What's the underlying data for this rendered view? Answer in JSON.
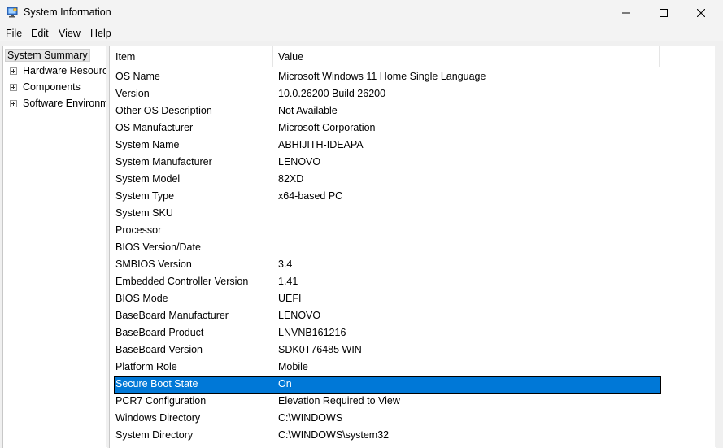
{
  "window": {
    "title": "System Information",
    "icon": "system-info-icon"
  },
  "menu": [
    "File",
    "Edit",
    "View",
    "Help"
  ],
  "tree": {
    "items": [
      {
        "label": "System Summary",
        "selected": true
      },
      {
        "label": "Hardware Resources",
        "expander": "+"
      },
      {
        "label": "Components",
        "expander": "+"
      },
      {
        "label": "Software Environment",
        "expander": "+"
      }
    ]
  },
  "table": {
    "columns": [
      "Item",
      "Value"
    ],
    "rows": [
      [
        "OS Name",
        "Microsoft Windows 11 Home Single Language"
      ],
      [
        "Version",
        "10.0.26200 Build 26200"
      ],
      [
        "Other OS Description",
        "Not Available"
      ],
      [
        "OS Manufacturer",
        "Microsoft Corporation"
      ],
      [
        "System Name",
        "ABHIJITH-IDEAPA"
      ],
      [
        "System Manufacturer",
        "LENOVO"
      ],
      [
        "System Model",
        "82XD"
      ],
      [
        "System Type",
        "x64-based PC"
      ],
      [
        "System SKU",
        ""
      ],
      [
        "Processor",
        ""
      ],
      [
        "BIOS Version/Date",
        ""
      ],
      [
        "SMBIOS Version",
        "3.4"
      ],
      [
        "Embedded Controller Version",
        "1.41"
      ],
      [
        "BIOS Mode",
        "UEFI"
      ],
      [
        "BaseBoard Manufacturer",
        "LENOVO"
      ],
      [
        "BaseBoard Product",
        "LNVNB161216"
      ],
      [
        "BaseBoard Version",
        "SDK0T76485 WIN"
      ],
      [
        "Platform Role",
        "Mobile"
      ],
      [
        "Secure Boot State",
        "On"
      ],
      [
        "PCR7 Configuration",
        "Elevation Required to View"
      ],
      [
        "Windows Directory",
        "C:\\WINDOWS"
      ],
      [
        "System Directory",
        "C:\\WINDOWS\\system32"
      ]
    ],
    "selected_row": "Secure Boot State"
  },
  "colors": {
    "selection": "#0078d7",
    "background": "#f0f0f0"
  }
}
